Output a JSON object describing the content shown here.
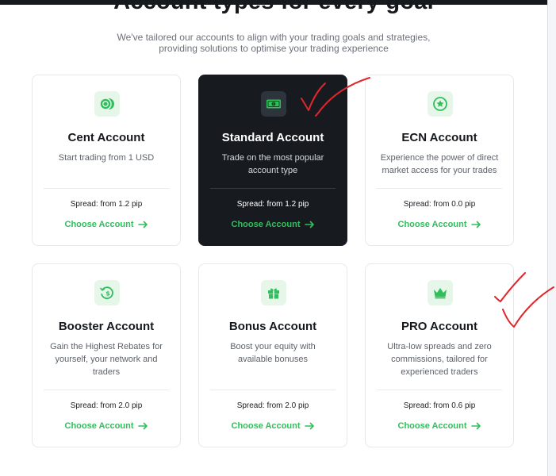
{
  "section": {
    "title": "Account types for every goal",
    "subtitle_line1": "We've tailored our accounts to align with your trading goals and strategies,",
    "subtitle_line2": "providing solutions to optimise your trading experience"
  },
  "cards": [
    {
      "title": "Cent Account",
      "desc_lines": [
        "Start trading from 1 USD"
      ],
      "spread": "Spread: from 1.2 pip",
      "cta": "Choose Account",
      "icon": "coins-icon",
      "highlighted": false
    },
    {
      "title": "Standard Account",
      "desc_lines": [
        "Trade on the most popular",
        "account type"
      ],
      "spread": "Spread: from 1.2 pip",
      "cta": "Choose Account",
      "icon": "banknote-icon",
      "highlighted": true
    },
    {
      "title": "ECN Account",
      "desc_lines": [
        "Experience the power of direct",
        "market access for your trades"
      ],
      "spread": "Spread: from 0.0 pip",
      "cta": "Choose Account",
      "icon": "star-badge-icon",
      "highlighted": false
    },
    {
      "title": "Booster Account",
      "desc_lines": [
        "Gain the Highest Rebates for",
        "yourself, your network and",
        "traders"
      ],
      "spread": "Spread: from 2.0 pip",
      "cta": "Choose Account",
      "icon": "rebate-dollar-icon",
      "highlighted": false
    },
    {
      "title": "Bonus Account",
      "desc_lines": [
        "Boost your equity with",
        "available bonuses"
      ],
      "spread": "Spread: from 2.0 pip",
      "cta": "Choose Account",
      "icon": "gift-icon",
      "highlighted": false
    },
    {
      "title": "PRO Account",
      "desc_lines": [
        "Ultra-low spreads and zero",
        "commissions, tailored for",
        "experienced traders"
      ],
      "spread": "Spread: from 0.6 pip",
      "cta": "Choose Account",
      "icon": "crown-icon",
      "highlighted": false
    }
  ],
  "colors": {
    "accent_green": "#2fbf5b",
    "dark_card": "#171b20",
    "annotation_red": "#e0262d"
  },
  "annotations": [
    "checkmark-icon",
    "checkmark-icon"
  ]
}
